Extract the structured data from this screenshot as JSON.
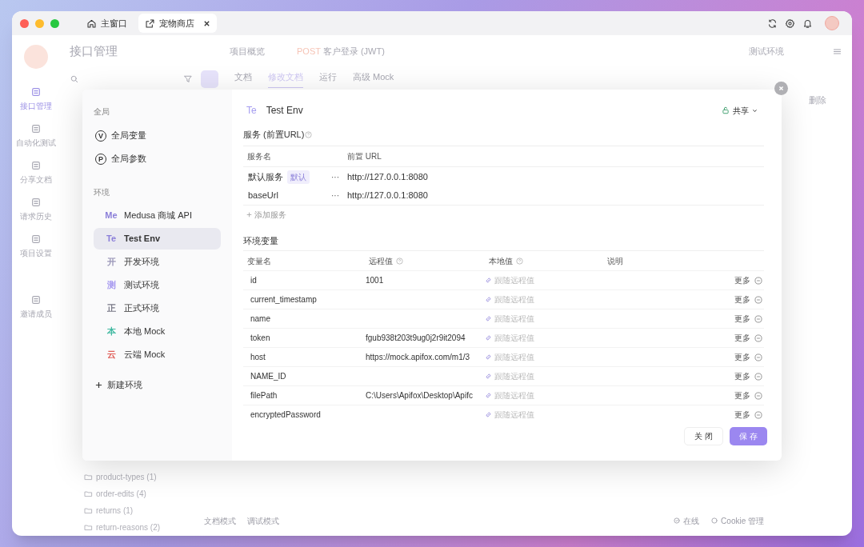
{
  "window_tabs": [
    {
      "kind": "home",
      "label": "主窗口",
      "selected": false,
      "closable": false
    },
    {
      "kind": "project",
      "label": "宠物商店",
      "selected": true,
      "closable": true
    }
  ],
  "app": {
    "section_title": "接口管理",
    "header_tabs": [
      {
        "kind": "overview",
        "label": "项目概览"
      },
      {
        "kind": "endpoint",
        "method": "POST",
        "label": "客户登录 (JWT)"
      }
    ],
    "env_label": "测试环境",
    "doc_tabs": [
      {
        "label": "文档",
        "selected": false
      },
      {
        "label": "修改文档",
        "selected": true
      },
      {
        "label": "运行",
        "selected": false
      },
      {
        "label": "高级 Mock",
        "selected": false
      }
    ],
    "nav": [
      {
        "label": "接口管理",
        "selected": true
      },
      {
        "label": "自动化测试",
        "selected": false
      },
      {
        "label": "分享文档",
        "selected": false
      },
      {
        "label": "请求历史",
        "selected": false
      },
      {
        "label": "项目设置",
        "selected": false
      },
      {
        "label": "邀请成员",
        "selected": false
      }
    ],
    "delete_label": "删除",
    "tree": [
      {
        "label": "product-types",
        "count": "(1)"
      },
      {
        "label": "order-edits",
        "count": "(4)"
      },
      {
        "label": "returns",
        "count": "(1)"
      },
      {
        "label": "return-reasons",
        "count": "(2)"
      }
    ],
    "footer_left": [
      "文档模式",
      "调试模式"
    ],
    "footer_right": [
      {
        "kind": "online",
        "label": "在线"
      },
      {
        "kind": "cookie",
        "label": "Cookie 管理"
      }
    ]
  },
  "modal": {
    "sidebar": {
      "global_heading": "全局",
      "global_items": [
        {
          "badge": "V",
          "label": "全局变量"
        },
        {
          "badge": "P",
          "label": "全局参数"
        }
      ],
      "env_heading": "环境",
      "environments": [
        {
          "badge": "Me",
          "label": "Medusa 商城 API",
          "color": "#8b7fd9",
          "selected": false
        },
        {
          "badge": "Te",
          "label": "Test Env",
          "color": "#8b7fd9",
          "selected": true
        },
        {
          "badge": "开",
          "label": "开发环境",
          "color": "#9b97b8",
          "selected": false
        },
        {
          "badge": "测",
          "label": "测试环境",
          "color": "#a79af0",
          "selected": false
        },
        {
          "badge": "正",
          "label": "正式环境",
          "color": "#7a7a88",
          "selected": false
        },
        {
          "badge": "本",
          "label": "本地 Mock",
          "color": "#3fb8a0",
          "selected": false
        },
        {
          "badge": "云",
          "label": "云端 Mock",
          "color": "#e0605a",
          "selected": false
        }
      ],
      "new_label": "新建环境"
    },
    "detail": {
      "badge": "Te",
      "title": "Test Env",
      "share_label": "共享",
      "services_title": "服务 (前置URL)",
      "service_columns": [
        "服务名",
        "前置 URL"
      ],
      "services": [
        {
          "name": "默认服务",
          "tag": "默认",
          "more": "···",
          "url": "http://127.0.0.1:8080"
        },
        {
          "name": "baseUrl",
          "more": "···",
          "url": "http://127.0.0.1:8080"
        }
      ],
      "add_service": "添加服务",
      "variables_title": "环境变量",
      "variable_columns": [
        {
          "label": "变量名",
          "help": false
        },
        {
          "label": "远程值",
          "help": true
        },
        {
          "label": "本地值",
          "help": true
        },
        {
          "label": "说明",
          "help": false
        }
      ],
      "variables": [
        {
          "name": "id",
          "remote": "1001",
          "local_placeholder": "跟随远程值",
          "more": "更多"
        },
        {
          "name": "current_timestamp",
          "local_placeholder": "跟随远程值",
          "more": "更多"
        },
        {
          "name": "name",
          "local_placeholder": "跟随远程值",
          "more": "更多"
        },
        {
          "name": "token",
          "remote": "fgub938t203t9ug0j2r9it2094",
          "local_placeholder": "跟随远程值",
          "more": "更多"
        },
        {
          "name": "host",
          "remote": "https://mock.apifox.com/m1/3",
          "local_placeholder": "跟随远程值",
          "more": "更多"
        },
        {
          "name": "NAME_ID",
          "local_placeholder": "跟随远程值",
          "more": "更多"
        },
        {
          "name": "filePath",
          "remote": "C:\\Users\\Apifox\\Desktop\\Apifc",
          "local_placeholder": "跟随远程值",
          "more": "更多"
        },
        {
          "name": "encryptedPassword",
          "local_placeholder": "跟随远程值",
          "more": "更多"
        }
      ]
    },
    "buttons": [
      {
        "kind": "secondary",
        "label": "关 闭"
      },
      {
        "kind": "primary",
        "label": "保 存"
      }
    ]
  }
}
